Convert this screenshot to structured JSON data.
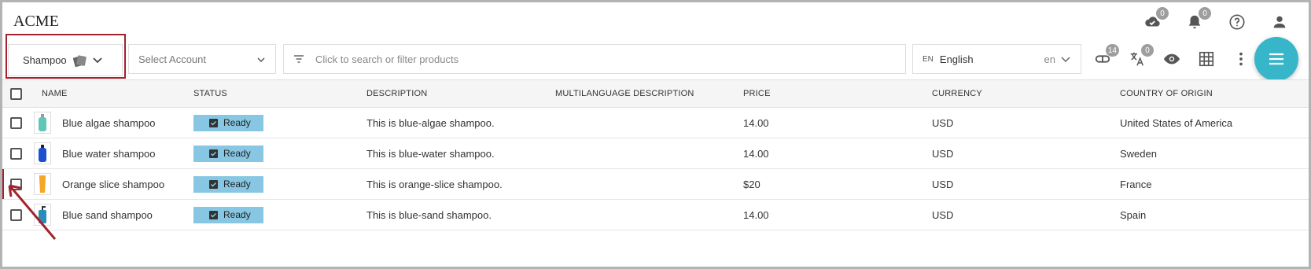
{
  "app": {
    "brand": "ACME"
  },
  "header_icons": [
    {
      "name": "cloud-check-icon",
      "badge": "0"
    },
    {
      "name": "bell-icon",
      "badge": "0"
    },
    {
      "name": "help-icon"
    },
    {
      "name": "user-icon"
    }
  ],
  "toolbar": {
    "catalog": "Shampoo",
    "account_placeholder": "Select Account",
    "search_placeholder": "Click to search or filter products",
    "language": {
      "code": "EN",
      "label": "English",
      "short": "en"
    },
    "icons": [
      {
        "name": "attributes-icon",
        "badge": "14"
      },
      {
        "name": "translate-icon",
        "badge": "0"
      },
      {
        "name": "eye-icon"
      },
      {
        "name": "grid-icon"
      },
      {
        "name": "more-vertical-icon"
      }
    ]
  },
  "table": {
    "columns": [
      "NAME",
      "STATUS",
      "DESCRIPTION",
      "MULTILANGUAGE DESCRIPTION",
      "PRICE",
      "CURRENCY",
      "COUNTRY OF ORIGIN"
    ],
    "rows": [
      {
        "name": "Blue algae shampoo",
        "status": "Ready",
        "description": "This is blue-algae shampoo.",
        "multilanguage_description": "",
        "price": "14.00",
        "currency": "USD",
        "country": "United States of America",
        "thumb_color": "#5fc7b8"
      },
      {
        "name": "Blue water shampoo",
        "status": "Ready",
        "description": "This is blue-water shampoo.",
        "multilanguage_description": "",
        "price": "14.00",
        "currency": "USD",
        "country": "Sweden",
        "thumb_color": "#1f4fd1"
      },
      {
        "name": "Orange slice shampoo",
        "status": "Ready",
        "description": "This is orange-slice shampoo.",
        "multilanguage_description": "",
        "price": "$20",
        "currency": "USD",
        "country": "France",
        "thumb_color": "#f5a623"
      },
      {
        "name": "Blue sand shampoo",
        "status": "Ready",
        "description": "This is blue-sand shampoo.",
        "multilanguage_description": "",
        "price": "14.00",
        "currency": "USD",
        "country": "Spain",
        "thumb_color": "#2a8fb8"
      }
    ]
  },
  "colors": {
    "accent": "#38b6c9",
    "status_ready": "#87c7e3",
    "highlight": "#a3232c"
  }
}
